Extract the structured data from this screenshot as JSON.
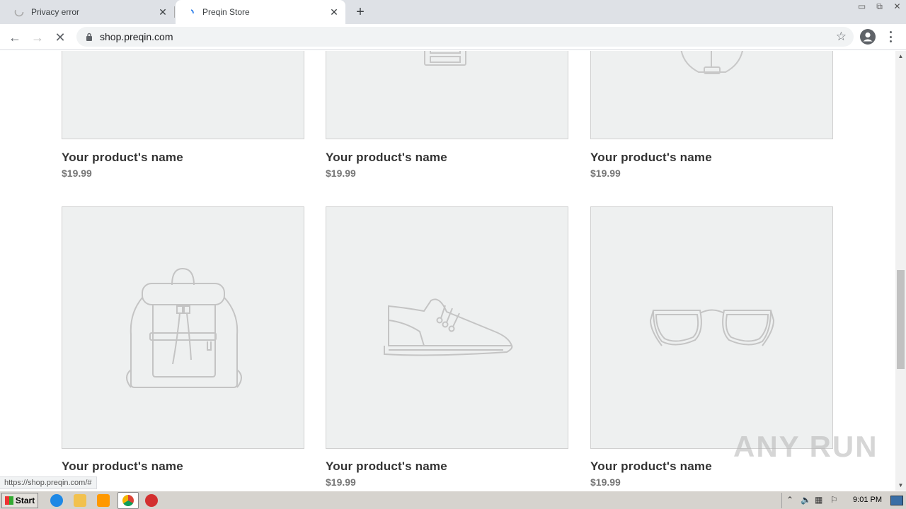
{
  "browser": {
    "tabs": [
      {
        "title": "Privacy error"
      },
      {
        "title": "Preqin Store"
      }
    ],
    "new_tab": "+",
    "url": "shop.preqin.com",
    "status_url": "https://shop.preqin.com/#"
  },
  "products": [
    {
      "name": "Your product's name",
      "price": "$19.99",
      "icon": "accessory-icon"
    },
    {
      "name": "Your product's name",
      "price": "$19.99",
      "icon": "cabinet-icon"
    },
    {
      "name": "Your product's name",
      "price": "$19.99",
      "icon": "bag-icon"
    },
    {
      "name": "Your product's name",
      "price": "",
      "icon": "backpack-icon"
    },
    {
      "name": "Your product's name",
      "price": "$19.99",
      "icon": "sneaker-icon"
    },
    {
      "name": "Your product's name",
      "price": "$19.99",
      "icon": "sunglasses-icon"
    }
  ],
  "watermark": "ANY RUN",
  "taskbar": {
    "start": "Start",
    "clock": "9:01 PM"
  }
}
